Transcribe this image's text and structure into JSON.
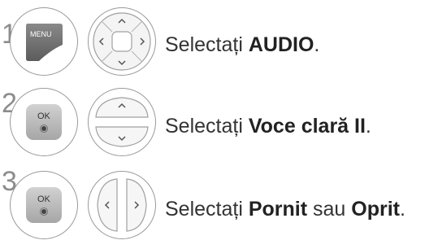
{
  "steps": [
    {
      "number": "1",
      "button_label": "MENU",
      "button_icon": "menu-button-icon",
      "pad_icon": "four-way-navigation-pad-icon",
      "text_prefix": "Selectați ",
      "text_bold": "AUDIO",
      "text_suffix": "."
    },
    {
      "number": "2",
      "button_label": "OK",
      "button_icon": "ok-button-icon",
      "pad_icon": "up-down-navigation-icon",
      "text_prefix": "Selectați ",
      "text_bold": "Voce clară II",
      "text_suffix": "."
    },
    {
      "number": "3",
      "button_label": "OK",
      "button_icon": "ok-button-icon",
      "pad_icon": "left-right-navigation-icon",
      "text_prefix": "Selectați ",
      "text_bold": "Pornit",
      "text_middle": " sau ",
      "text_bold2": "Oprit",
      "text_suffix": "."
    }
  ],
  "colors": {
    "menu_key": "#6f6f6f",
    "ok_key": "#b9b9b9",
    "outline": "#9a9a9a",
    "text": "#333333",
    "step_number": "#8c8c8c"
  }
}
